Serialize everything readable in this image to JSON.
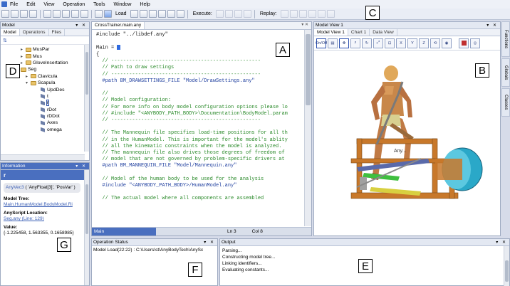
{
  "menu": {
    "items": [
      "File",
      "Edit",
      "View",
      "Operation",
      "Tools",
      "Window",
      "Help"
    ]
  },
  "toolbar": {
    "load_label": "Load",
    "execute_label": "Execute:",
    "replay_label": "Replay:"
  },
  "model_panel": {
    "title": "Model",
    "tabs": [
      "Model",
      "Operations",
      "Files"
    ],
    "tree": [
      {
        "label": "MusPar",
        "kind": "folder",
        "indent": 4
      },
      {
        "label": "Mus",
        "kind": "folder",
        "indent": 4
      },
      {
        "label": "GloveInsertation",
        "kind": "folder",
        "indent": 4
      },
      {
        "label": "Seg",
        "kind": "folder",
        "indent": 3
      },
      {
        "label": "Clavicula",
        "kind": "folder",
        "indent": 5
      },
      {
        "label": "Scapula",
        "kind": "folder",
        "indent": 5
      },
      {
        "label": "UpdDes",
        "kind": "var",
        "indent": 7
      },
      {
        "label": "t",
        "kind": "var",
        "indent": 7
      },
      {
        "label": "r",
        "kind": "var",
        "indent": 7
      },
      {
        "label": "rDot",
        "kind": "var",
        "indent": 7
      },
      {
        "label": "rDDot",
        "kind": "var",
        "indent": 7
      },
      {
        "label": "Axes",
        "kind": "var",
        "indent": 7
      },
      {
        "label": "omega",
        "kind": "var",
        "indent": 7
      }
    ]
  },
  "info_panel": {
    "title": "Information",
    "header": "r",
    "type_line": "AnyVec3",
    "type_detail": "( 'AnyFloat[3]', 'PosVar' )",
    "model_tree_label": "Model Tree:",
    "model_tree_value": "Main.HumanModel.BodyModel.Ri",
    "location_label": "AnyScript Location:",
    "location_value": "Seg.any (Line: 129)",
    "value_label": "Value:",
    "value_text": "{-1.225458, 1.563355, 0.1658985}"
  },
  "editor": {
    "tab": "CrossTrainer.main.any",
    "lines": [
      {
        "t": "#include \"../libdef.any\"",
        "c": "tx"
      },
      {
        "t": "",
        "c": "tx"
      },
      {
        "t": "Main = ",
        "c": "tx",
        "cursor": true
      },
      {
        "t": "{",
        "c": "tx"
      },
      {
        "t": "  // --------------------------------------------------",
        "c": "cm"
      },
      {
        "t": "  // Path to draw settings",
        "c": "cm"
      },
      {
        "t": "  // --------------------------------------------------",
        "c": "cm"
      },
      {
        "t": "  #path BM_DRAWSETTINGS_FILE \"Model/DrawSettings.any\"",
        "c": "kw"
      },
      {
        "t": "",
        "c": "tx"
      },
      {
        "t": "  //",
        "c": "cm"
      },
      {
        "t": "  // Model configuration:",
        "c": "cm"
      },
      {
        "t": "  // For more info on body model configuration options please lo",
        "c": "cm"
      },
      {
        "t": "  // #include \"<ANYBODY_PATH_BODY>\\Documentation\\BodyModel.param",
        "c": "cm"
      },
      {
        "t": "  // --------------------------------------------------",
        "c": "cm"
      },
      {
        "t": "",
        "c": "tx"
      },
      {
        "t": "  // The Mannequin file specifies load-time positions for all th",
        "c": "cm"
      },
      {
        "t": "  // in the HumanModel. This is important for the model's ablity",
        "c": "cm"
      },
      {
        "t": "  // all the kinematic constraints when the model is analyzed.",
        "c": "cm"
      },
      {
        "t": "  // The mannequin file also drives those degrees of freedom of",
        "c": "cm"
      },
      {
        "t": "  // model that are not governed by problem-specific drivers at",
        "c": "cm"
      },
      {
        "t": "  #path BM_MANNEQUIN_FILE \"Model/Mannequin.any\"",
        "c": "kw"
      },
      {
        "t": "",
        "c": "tx"
      },
      {
        "t": "  // Model of the human body to be used for the analysis",
        "c": "cm"
      },
      {
        "t": "  #include \"<ANYBODY_PATH_BODY>/HumanModel.any\"",
        "c": "kw"
      },
      {
        "t": "",
        "c": "tx"
      },
      {
        "t": "  // The actual model where all components are assembled",
        "c": "cm"
      }
    ],
    "status_name": "Main",
    "status_ln": "Ln 3",
    "status_col": "Col 8"
  },
  "model_view": {
    "title": "Model View 1",
    "tabs": [
      "Model View 1",
      "Chart 1",
      "Data View"
    ],
    "btn_onoff": "On/Off",
    "object_label": "Any..."
  },
  "side_tabs": [
    "Functions",
    "Globals",
    "Classes"
  ],
  "operation_status": {
    "title": "Operation Status",
    "line": "Model Load(22:22) : C:\\Users\\st\\AnyBodyTech\\AnySc"
  },
  "output": {
    "title": "Output",
    "lines": [
      "Parsing...",
      "Constructing model tree...",
      "Linking identifiers...",
      "Evaluating constants..."
    ]
  },
  "annotations": [
    "A",
    "B",
    "C",
    "D",
    "E",
    "F",
    "G"
  ],
  "colors": {
    "accent": "#4a6fbf",
    "comment": "#2a8a2a",
    "keyword": "#1f3f9f"
  }
}
